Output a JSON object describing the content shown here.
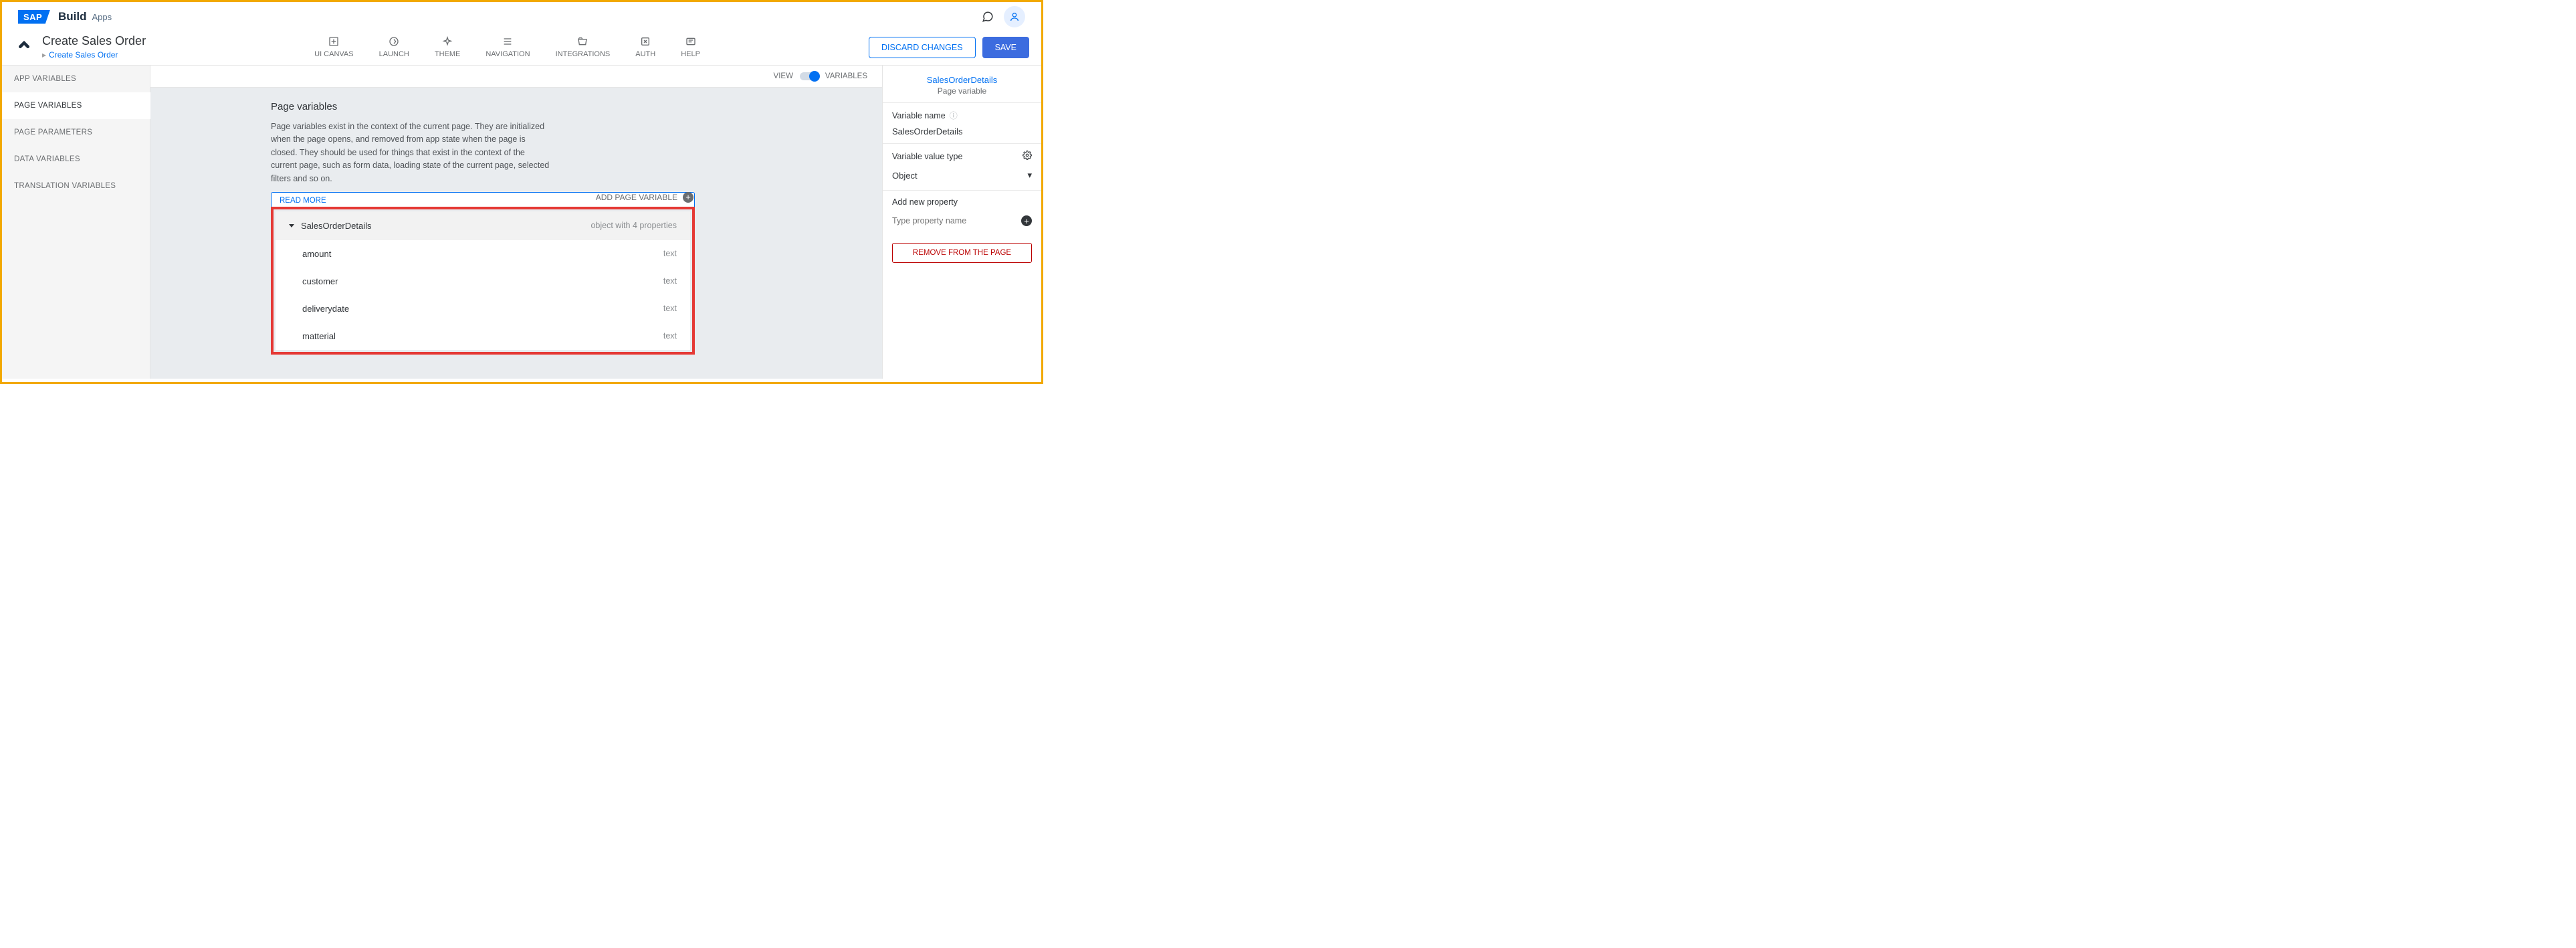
{
  "brand": {
    "sap": "SAP",
    "build": "Build",
    "apps": "Apps"
  },
  "header": {
    "title": "Create Sales Order",
    "breadcrumb": "Create Sales Order",
    "actions": {
      "discard": "DISCARD CHANGES",
      "save": "SAVE"
    }
  },
  "nav": [
    {
      "label": "UI CANVAS"
    },
    {
      "label": "LAUNCH"
    },
    {
      "label": "THEME"
    },
    {
      "label": "NAVIGATION"
    },
    {
      "label": "INTEGRATIONS"
    },
    {
      "label": "AUTH"
    },
    {
      "label": "HELP"
    }
  ],
  "sidebar": [
    {
      "label": "APP VARIABLES"
    },
    {
      "label": "PAGE VARIABLES"
    },
    {
      "label": "PAGE PARAMETERS"
    },
    {
      "label": "DATA VARIABLES"
    },
    {
      "label": "TRANSLATION VARIABLES"
    }
  ],
  "canvas": {
    "toggle_left": "VIEW",
    "toggle_right": "VARIABLES",
    "section_title": "Page variables",
    "section_desc": "Page variables exist in the context of the current page. They are initialized when the page opens, and removed from app state when the page is closed. They should be used for things that exist in the context of the current page, such as form data, loading state of the current page, selected filters and so on.",
    "read_more": "READ MORE",
    "add_variable": "ADD PAGE VARIABLE",
    "variable": {
      "name": "SalesOrderDetails",
      "type_summary": "object with 4 properties",
      "props": [
        {
          "name": "amount",
          "type": "text"
        },
        {
          "name": "customer",
          "type": "text"
        },
        {
          "name": "deliverydate",
          "type": "text"
        },
        {
          "name": "matterial",
          "type": "text"
        }
      ]
    }
  },
  "rightpanel": {
    "name": "SalesOrderDetails",
    "kind": "Page variable",
    "var_name_label": "Variable name",
    "var_name_value": "SalesOrderDetails",
    "var_type_label": "Variable value type",
    "var_type_value": "Object",
    "add_prop_label": "Add new property",
    "add_prop_placeholder": "Type property name",
    "remove": "REMOVE FROM THE PAGE"
  }
}
